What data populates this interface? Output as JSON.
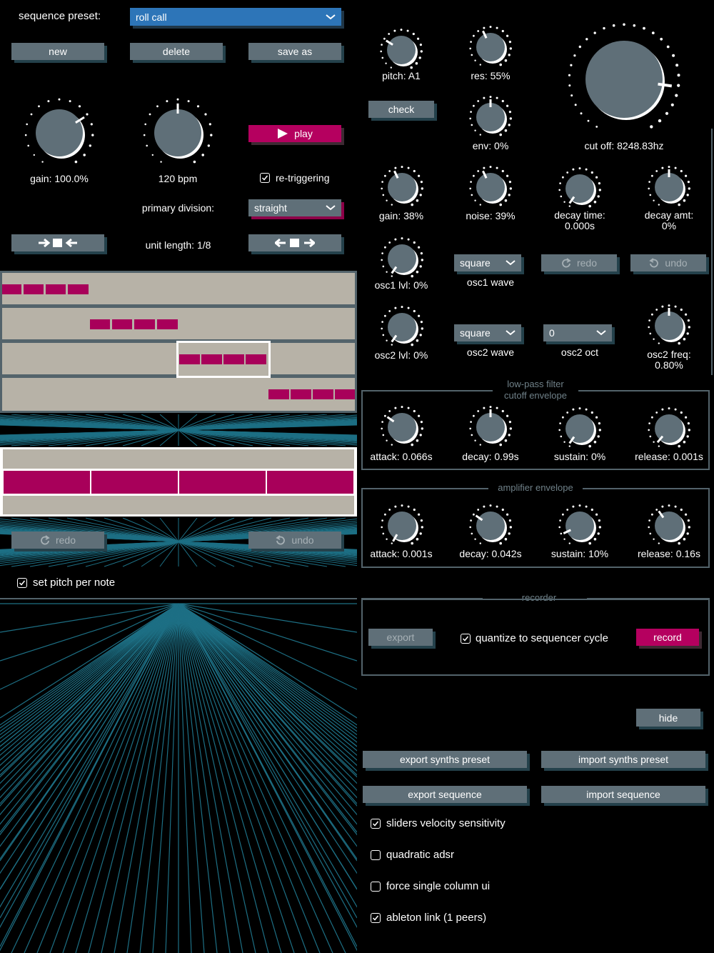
{
  "sequencer": {
    "preset_label": "sequence preset:",
    "preset_value": "roll call",
    "new_label": "new",
    "delete_label": "delete",
    "save_as_label": "save as",
    "gain_label": "gain: 100.0%",
    "bpm_label": "120 bpm",
    "play_label": "play",
    "retrigger_label": "re-triggering",
    "retrigger_checked": true,
    "primary_division_label": "primary division:",
    "primary_division_value": "straight",
    "unit_length_label": "unit length: 1/8",
    "shift_left_icon": "shift-inward-icon",
    "shift_right_icon": "shift-outward-icon",
    "redo_label": "redo",
    "undo_label": "undo",
    "set_pitch_label": "set pitch per note",
    "set_pitch_checked": true,
    "colors": {
      "note": "#a8005a",
      "lane": "#b7b2a7",
      "button": "#5f6f78",
      "accent": "#b5005f",
      "dropdown": "#2d75b8"
    }
  },
  "synth": {
    "pitch_label": "pitch: A1",
    "res_label": "res: 55%",
    "check_label": "check",
    "env_label": "env: 0%",
    "cutoff_label": "cut off: 8248.83hz",
    "gain_label": "gain: 38%",
    "noise_label": "noise: 39%",
    "decay_time_label": "decay time:",
    "decay_time_value": "0.000s",
    "decay_amt_label": "decay amt:",
    "decay_amt_value": "0%",
    "osc1_lvl_label": "osc1 lvl: 0%",
    "osc1_wave_value": "square",
    "osc1_wave_label": "osc1 wave",
    "redo_label": "redo",
    "undo_label": "undo",
    "osc2_lvl_label": "osc2 lvl: 0%",
    "osc2_wave_value": "square",
    "osc2_wave_label": "osc2 wave",
    "osc2_oct_value": "0",
    "osc2_oct_label": "osc2 oct",
    "osc2_freq_label": "osc2 freq:",
    "osc2_freq_value": "0.80%"
  },
  "filter_env": {
    "title_line1": "low-pass filter",
    "title_line2": "cutoff envelope",
    "attack": "attack: 0.066s",
    "decay": "decay: 0.99s",
    "sustain": "sustain: 0%",
    "release": "release: 0.001s"
  },
  "amp_env": {
    "title": "amplifier envelope",
    "attack": "attack: 0.001s",
    "decay": "decay: 0.042s",
    "sustain": "sustain: 10%",
    "release": "release: 0.16s"
  },
  "recorder": {
    "title": "recorder",
    "export_label": "export",
    "quantize_label": "quantize to sequencer cycle",
    "quantize_checked": true,
    "record_label": "record"
  },
  "settings": {
    "hide_label": "hide",
    "export_synths_label": "export synths preset",
    "import_synths_label": "import synths preset",
    "export_sequence_label": "export sequence",
    "import_sequence_label": "import sequence",
    "velocity_label": "sliders velocity sensitivity",
    "velocity_checked": true,
    "quadratic_label": "quadratic adsr",
    "quadratic_checked": false,
    "single_column_label": "force single column ui",
    "single_column_checked": false,
    "ableton_label": "ableton link (1 peers)",
    "ableton_checked": true
  }
}
